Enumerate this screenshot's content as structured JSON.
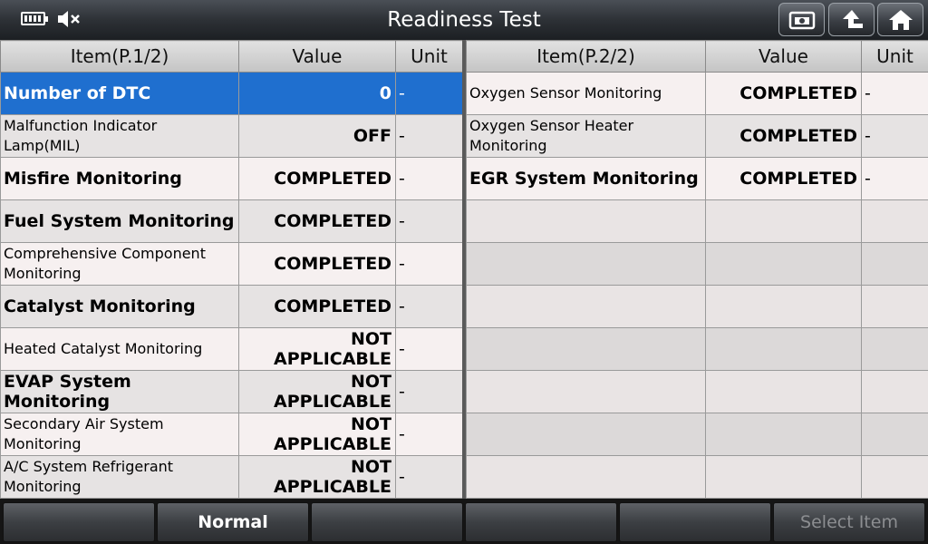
{
  "title": "Readiness Test",
  "table_left": {
    "headers": [
      "Item(P.1/2)",
      "Value",
      "Unit"
    ],
    "rows": [
      {
        "name": "Number of DTC",
        "value": "0",
        "unit": "-"
      },
      {
        "name": "Malfunction Indicator Lamp(MIL)",
        "value": "OFF",
        "unit": "-"
      },
      {
        "name": "Misfire Monitoring",
        "value": "COMPLETED",
        "unit": "-"
      },
      {
        "name": "Fuel System Monitoring",
        "value": "COMPLETED",
        "unit": "-"
      },
      {
        "name": "Comprehensive Component Monitoring",
        "value": "COMPLETED",
        "unit": "-"
      },
      {
        "name": "Catalyst Monitoring",
        "value": "COMPLETED",
        "unit": "-"
      },
      {
        "name": "Heated Catalyst Monitoring",
        "value": "NOT APPLICABLE",
        "unit": "-"
      },
      {
        "name": "EVAP System Monitoring",
        "value": "NOT APPLICABLE",
        "unit": "-"
      },
      {
        "name": "Secondary Air System Monitoring",
        "value": "NOT APPLICABLE",
        "unit": "-"
      },
      {
        "name": "A/C System Refrigerant Monitoring",
        "value": "NOT APPLICABLE",
        "unit": "-"
      }
    ]
  },
  "table_right": {
    "headers": [
      "Item(P.2/2)",
      "Value",
      "Unit"
    ],
    "rows": [
      {
        "name": "Oxygen Sensor Monitoring",
        "value": "COMPLETED",
        "unit": "-"
      },
      {
        "name": "Oxygen Sensor Heater Monitoring",
        "value": "COMPLETED",
        "unit": "-"
      },
      {
        "name": "EGR System Monitoring",
        "value": "COMPLETED",
        "unit": "-"
      }
    ]
  },
  "bottom_buttons": [
    "",
    "Normal",
    "",
    "",
    "",
    "Select Item"
  ],
  "icons": {
    "battery": "battery-icon",
    "mute": "speaker-mute-icon",
    "screenshot": "screenshot-icon",
    "back": "back-arrow-icon",
    "home": "home-icon"
  },
  "colors": {
    "selected_row": "#1f6fcf"
  }
}
